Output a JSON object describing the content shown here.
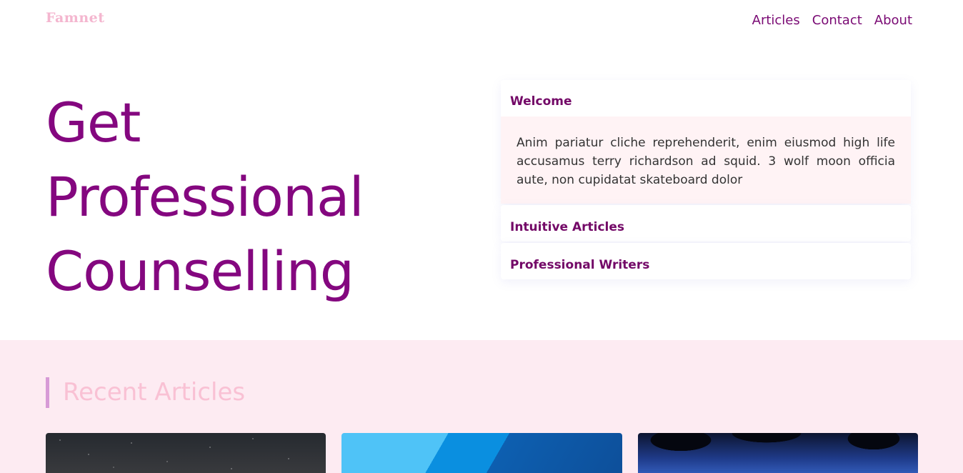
{
  "brand": {
    "logo": "Famnet"
  },
  "nav": {
    "items": [
      "Articles",
      "Contact",
      "About"
    ]
  },
  "hero": {
    "lines": [
      "Get",
      "Professional",
      "Counselling"
    ]
  },
  "accordion": {
    "items": [
      {
        "title": "Welcome",
        "body": "Anim pariatur cliche reprehenderit, enim eiusmod high life accusamus terry richardson ad squid. 3 wolf moon officia aute, non cupidatat skateboard dolor",
        "expanded": true
      },
      {
        "title": "Intuitive Articles",
        "expanded": false
      },
      {
        "title": "Professional Writers",
        "expanded": false
      }
    ]
  },
  "recent": {
    "title": "Recent Articles",
    "cards": [
      {
        "image": "starry-night-sky-image"
      },
      {
        "image": "blue-geometric-image"
      },
      {
        "image": "palm-trees-night-image"
      }
    ]
  },
  "colors": {
    "accent": "#84077f",
    "nav": "#7a0a74",
    "logo": "#f4b6cf",
    "recent_bg": "#fdebf2",
    "recent_title": "#f9c1d4",
    "accordion_body_bg": "#fff3f5"
  }
}
